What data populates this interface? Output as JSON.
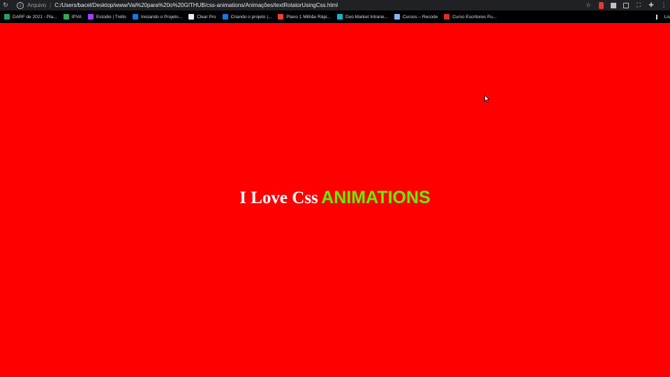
{
  "toolbar": {
    "reload_icon": "reload-icon",
    "scheme_label": "Arquivo",
    "url": "C:/Users/bacel/Desktop/www/Vai%20para%20o%20GITHUB/css-animations/Animações/textRotatorUsingCss.html",
    "icons": [
      "info-icon",
      "star-icon",
      "extension-red-icon",
      "extension-square-icon",
      "screenshot-icon",
      "puzzle-icon",
      "avatar-icon"
    ]
  },
  "bookmarks": {
    "items": [
      {
        "label": "DARF de 2021 - Pla...",
        "color": "#1ea362"
      },
      {
        "label": "IPVA",
        "color": "#34a853"
      },
      {
        "label": "Estúdio | Trello",
        "color": "#a142f4"
      },
      {
        "label": "Iniciando o Projeto...",
        "color": "#1a73e8"
      },
      {
        "label": "Clear Pro",
        "color": "#e8eaed"
      },
      {
        "label": "Criando o projeto |...",
        "color": "#1a73e8"
      },
      {
        "label": "Plano 1 Milhão Rápi...",
        "color": "#ea4335"
      },
      {
        "label": "Duo Market Intrane...",
        "color": "#12b5cb"
      },
      {
        "label": "Cursos – Recode",
        "color": "#8ab4f8"
      },
      {
        "label": "Curso Escritores Pu...",
        "color": "#d93025"
      }
    ],
    "reading_list_label": "Lis"
  },
  "page": {
    "background": "#ff0000",
    "static_text": "I Love Css",
    "rotating_word": "ANIMATIONS",
    "rotating_color": "#66ee00"
  }
}
